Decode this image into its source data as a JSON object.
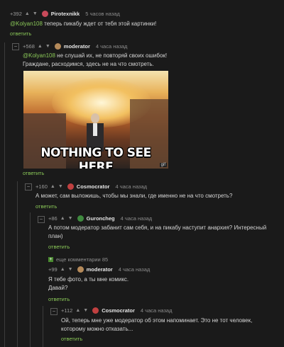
{
  "comments": [
    {
      "rating": "+392",
      "nick": "Pirotexnikk",
      "time": "5 часов назад",
      "mention": "@Kolyan108",
      "text": " теперь пикабу ждет от тебя этой картинки!",
      "reply": "ответить"
    },
    {
      "rating": "+568",
      "nick": "moderator",
      "time": "4 часа назад",
      "mention": "@Kolyan108",
      "text_line1": " не слушай их, не повторяй своих ошибок!",
      "text_line2": "Граждане, расходимся, здесь не на что смотреть.",
      "image_caption": "NOTHING TO SEE HERE",
      "image_watermark": "gif",
      "reply": "ответить"
    },
    {
      "rating": "+160",
      "nick": "Cosmocrator",
      "time": "4 часа назад",
      "text": "А может, сам выложишь, чтобы мы знали, где именно не на что смотреть?",
      "reply": "ответить"
    },
    {
      "rating": "+86",
      "nick": "Guroncheg",
      "time": "4 часа назад",
      "text_line1": "А потом модератор забанит сам себя, и на пикабу наступит анархия? Интересный",
      "text_line2": "план)",
      "reply": "ответить"
    },
    {
      "more_comments": "еще комментарии 85",
      "rating": "+99",
      "nick": "moderator",
      "time": "4 часа назад",
      "text_line1": "Я тебе фото, а ты мне комикс.",
      "text_line2": "Давай?",
      "reply": "ответить"
    },
    {
      "rating": "+112",
      "nick": "Cosmocrator",
      "time": "4 часа назад",
      "text_line1": "Ой, теперь мне уже модератор об этом напоминает. Это не тот человек,",
      "text_line2": "которому можно отказать...",
      "reply": "ответить"
    }
  ],
  "icons": {
    "upvote": "▲",
    "downvote": "▼",
    "collapse": "−",
    "expand": "+"
  },
  "colors": {
    "background": "#1a1a1a",
    "accent_green": "#8ac858",
    "text": "#d6d6d6",
    "muted": "#8d8d8d"
  }
}
